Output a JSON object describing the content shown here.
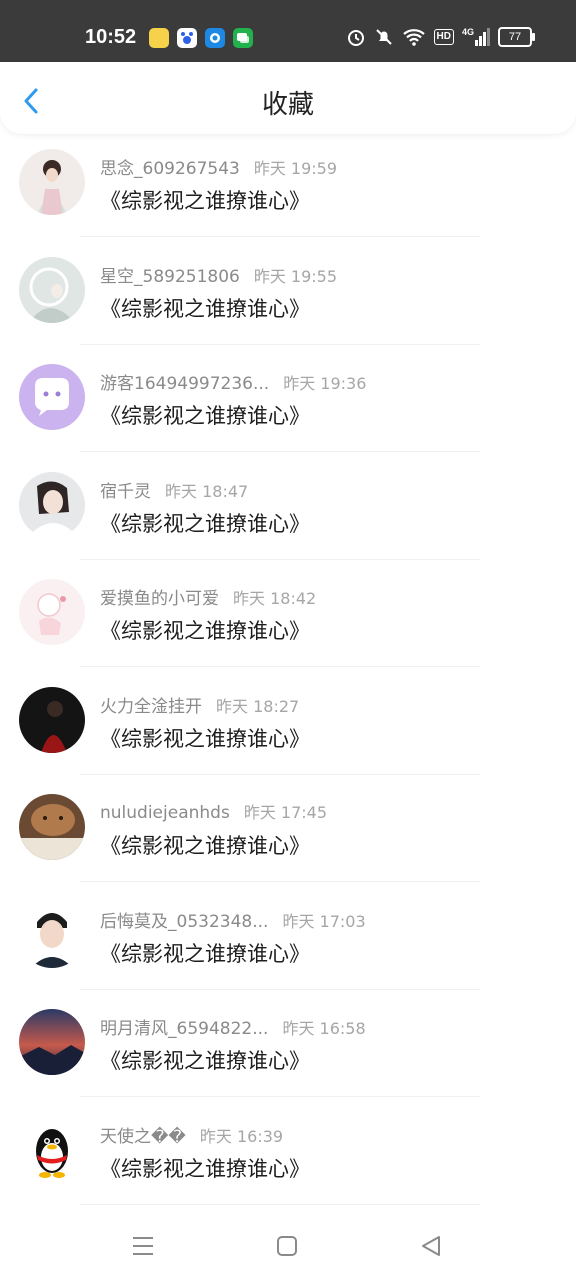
{
  "status": {
    "time": "10:52",
    "battery": "77",
    "hd": "HD",
    "network": "4G"
  },
  "header": {
    "title": "收藏"
  },
  "items": [
    {
      "name": "思念_609267543",
      "time": "昨天 19:59",
      "book": "《综影视之谁撩谁心》"
    },
    {
      "name": "星空_589251806",
      "time": "昨天 19:55",
      "book": "《综影视之谁撩谁心》"
    },
    {
      "name": "游客16494997236...",
      "time": "昨天 19:36",
      "book": "《综影视之谁撩谁心》"
    },
    {
      "name": "宿千灵",
      "time": "昨天 18:47",
      "book": "《综影视之谁撩谁心》"
    },
    {
      "name": "爱摸鱼的小可爱",
      "time": "昨天 18:42",
      "book": "《综影视之谁撩谁心》"
    },
    {
      "name": "火力全淦挂开",
      "time": "昨天 18:27",
      "book": "《综影视之谁撩谁心》"
    },
    {
      "name": "nuludiejeanhds",
      "time": "昨天 17:45",
      "book": "《综影视之谁撩谁心》"
    },
    {
      "name": "后悔莫及_0532348...",
      "time": "昨天 17:03",
      "book": "《综影视之谁撩谁心》"
    },
    {
      "name": "明月清风_6594822...",
      "time": "昨天 16:58",
      "book": "《综影视之谁撩谁心》"
    },
    {
      "name": "天使之��",
      "time": "昨天 16:39",
      "book": "《综影视之谁撩谁心》"
    }
  ],
  "colors": {
    "accent": "#2e9bf0",
    "statusbar": "#3b3b3b"
  }
}
